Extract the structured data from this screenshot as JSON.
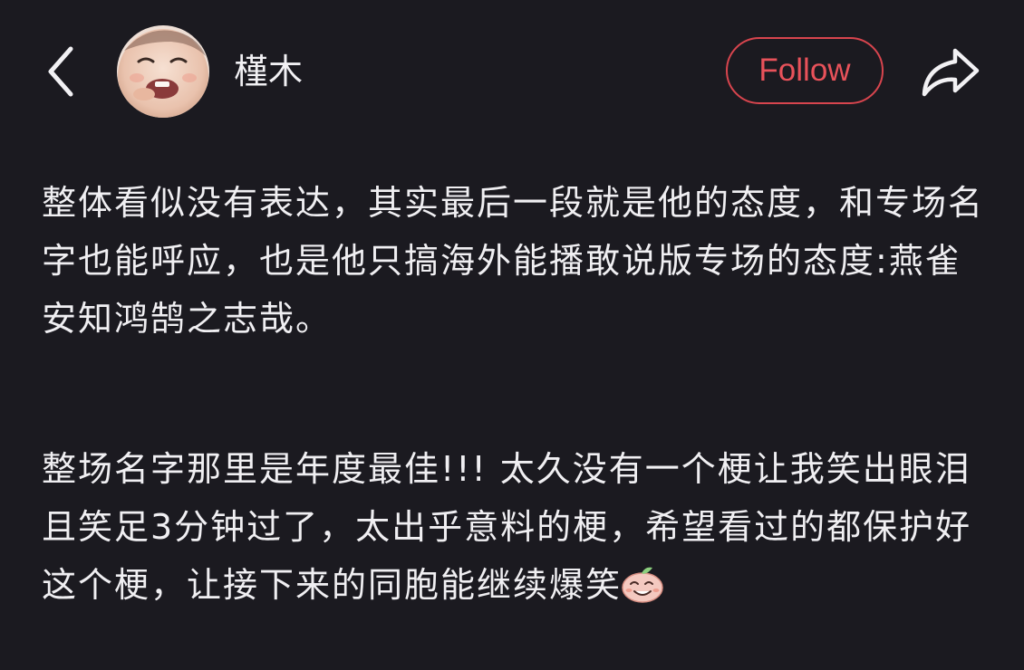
{
  "header": {
    "back_icon": "chevron-left-icon",
    "avatar_icon": "baby-photo-avatar",
    "username": "槿木",
    "follow_label": "Follow",
    "share_icon": "share-arrow-icon",
    "accent_color": "#d8454e"
  },
  "post": {
    "paragraphs": [
      "整体看似没有表达，其实最后一段就是他的态度，和专场名字也能呼应，也是他只搞海外能播敢说版专场的态度:燕雀安知鸿鹄之志哉。",
      "整场名字那里是年度最佳!!! 太久没有一个梗让我笑出眼泪且笑足3分钟过了，太出乎意料的梗，希望看过的都保护好这个梗，让接下来的同胞能继续爆笑"
    ],
    "trailing_emoji": "laughing-peach-emoji"
  },
  "theme": {
    "background": "#1b1a20",
    "text": "#f0eff2"
  }
}
